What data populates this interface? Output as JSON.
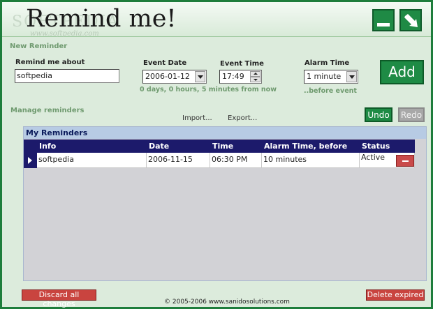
{
  "header": {
    "title": "Remind me!",
    "watermark": "SOFTPEDIA",
    "watermark_url": "www.softpedia.com",
    "minimize_icon": "minimize-icon",
    "close_icon": "close-arrow-icon"
  },
  "new_reminder": {
    "section_label": "New Reminder",
    "remind_label": "Remind me about",
    "remind_value": "softpedia",
    "date_label": "Event Date",
    "date_value": "2006-01-12",
    "time_label": "Event Time",
    "time_value": "17:49",
    "alarm_label": "Alarm Time",
    "alarm_value": "1 minute",
    "from_now_hint": "0 days, 0 hours, 5 minutes from now",
    "before_event_hint": "..before event",
    "add_label": "Add"
  },
  "manage": {
    "section_label": "Manage reminders",
    "import_label": "Import...",
    "export_label": "Export...",
    "undo_label": "Undo",
    "redo_label": "Redo"
  },
  "grid": {
    "title": "My Reminders",
    "columns": [
      "Info",
      "Date",
      "Time",
      "Alarm Time, before",
      "Status"
    ],
    "rows": [
      {
        "info": "softpedia",
        "date": "2006-11-15",
        "time": "06:30 PM",
        "alarm": "10 minutes",
        "status": "Active"
      }
    ]
  },
  "footer": {
    "discard_label": "Discard all changes",
    "delete_expired_label": "Delete expired",
    "copyright": "© 2005-2006 www.sanidosolutions.com"
  },
  "colors": {
    "accent_green": "#1e8b45",
    "grid_header": "#1c1a6b",
    "danger_red": "#c9443f"
  }
}
